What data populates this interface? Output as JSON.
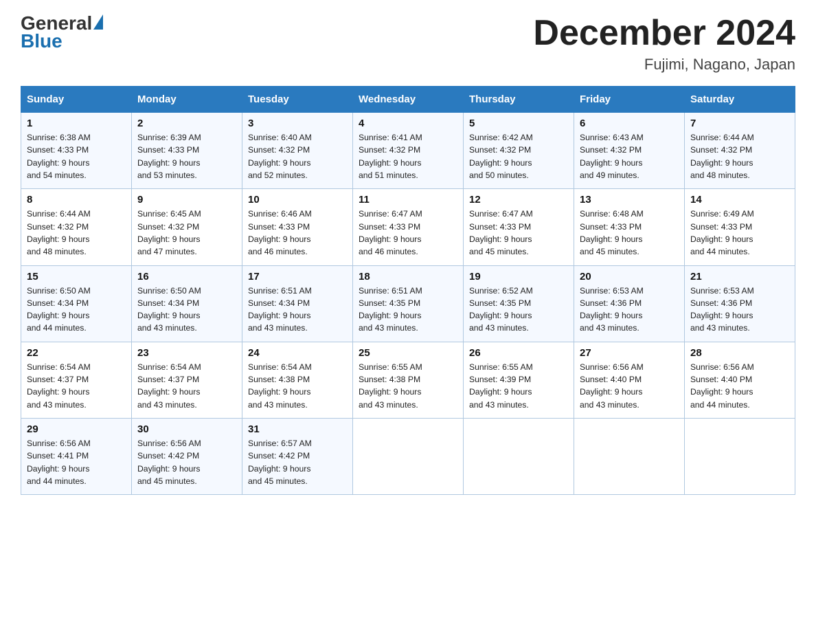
{
  "header": {
    "logo_general": "General",
    "logo_blue": "Blue",
    "month_title": "December 2024",
    "location": "Fujimi, Nagano, Japan"
  },
  "weekdays": [
    "Sunday",
    "Monday",
    "Tuesday",
    "Wednesday",
    "Thursday",
    "Friday",
    "Saturday"
  ],
  "weeks": [
    [
      {
        "day": "1",
        "sunrise": "6:38 AM",
        "sunset": "4:33 PM",
        "daylight": "9 hours and 54 minutes."
      },
      {
        "day": "2",
        "sunrise": "6:39 AM",
        "sunset": "4:33 PM",
        "daylight": "9 hours and 53 minutes."
      },
      {
        "day": "3",
        "sunrise": "6:40 AM",
        "sunset": "4:32 PM",
        "daylight": "9 hours and 52 minutes."
      },
      {
        "day": "4",
        "sunrise": "6:41 AM",
        "sunset": "4:32 PM",
        "daylight": "9 hours and 51 minutes."
      },
      {
        "day": "5",
        "sunrise": "6:42 AM",
        "sunset": "4:32 PM",
        "daylight": "9 hours and 50 minutes."
      },
      {
        "day": "6",
        "sunrise": "6:43 AM",
        "sunset": "4:32 PM",
        "daylight": "9 hours and 49 minutes."
      },
      {
        "day": "7",
        "sunrise": "6:44 AM",
        "sunset": "4:32 PM",
        "daylight": "9 hours and 48 minutes."
      }
    ],
    [
      {
        "day": "8",
        "sunrise": "6:44 AM",
        "sunset": "4:32 PM",
        "daylight": "9 hours and 48 minutes."
      },
      {
        "day": "9",
        "sunrise": "6:45 AM",
        "sunset": "4:32 PM",
        "daylight": "9 hours and 47 minutes."
      },
      {
        "day": "10",
        "sunrise": "6:46 AM",
        "sunset": "4:33 PM",
        "daylight": "9 hours and 46 minutes."
      },
      {
        "day": "11",
        "sunrise": "6:47 AM",
        "sunset": "4:33 PM",
        "daylight": "9 hours and 46 minutes."
      },
      {
        "day": "12",
        "sunrise": "6:47 AM",
        "sunset": "4:33 PM",
        "daylight": "9 hours and 45 minutes."
      },
      {
        "day": "13",
        "sunrise": "6:48 AM",
        "sunset": "4:33 PM",
        "daylight": "9 hours and 45 minutes."
      },
      {
        "day": "14",
        "sunrise": "6:49 AM",
        "sunset": "4:33 PM",
        "daylight": "9 hours and 44 minutes."
      }
    ],
    [
      {
        "day": "15",
        "sunrise": "6:50 AM",
        "sunset": "4:34 PM",
        "daylight": "9 hours and 44 minutes."
      },
      {
        "day": "16",
        "sunrise": "6:50 AM",
        "sunset": "4:34 PM",
        "daylight": "9 hours and 43 minutes."
      },
      {
        "day": "17",
        "sunrise": "6:51 AM",
        "sunset": "4:34 PM",
        "daylight": "9 hours and 43 minutes."
      },
      {
        "day": "18",
        "sunrise": "6:51 AM",
        "sunset": "4:35 PM",
        "daylight": "9 hours and 43 minutes."
      },
      {
        "day": "19",
        "sunrise": "6:52 AM",
        "sunset": "4:35 PM",
        "daylight": "9 hours and 43 minutes."
      },
      {
        "day": "20",
        "sunrise": "6:53 AM",
        "sunset": "4:36 PM",
        "daylight": "9 hours and 43 minutes."
      },
      {
        "day": "21",
        "sunrise": "6:53 AM",
        "sunset": "4:36 PM",
        "daylight": "9 hours and 43 minutes."
      }
    ],
    [
      {
        "day": "22",
        "sunrise": "6:54 AM",
        "sunset": "4:37 PM",
        "daylight": "9 hours and 43 minutes."
      },
      {
        "day": "23",
        "sunrise": "6:54 AM",
        "sunset": "4:37 PM",
        "daylight": "9 hours and 43 minutes."
      },
      {
        "day": "24",
        "sunrise": "6:54 AM",
        "sunset": "4:38 PM",
        "daylight": "9 hours and 43 minutes."
      },
      {
        "day": "25",
        "sunrise": "6:55 AM",
        "sunset": "4:38 PM",
        "daylight": "9 hours and 43 minutes."
      },
      {
        "day": "26",
        "sunrise": "6:55 AM",
        "sunset": "4:39 PM",
        "daylight": "9 hours and 43 minutes."
      },
      {
        "day": "27",
        "sunrise": "6:56 AM",
        "sunset": "4:40 PM",
        "daylight": "9 hours and 43 minutes."
      },
      {
        "day": "28",
        "sunrise": "6:56 AM",
        "sunset": "4:40 PM",
        "daylight": "9 hours and 44 minutes."
      }
    ],
    [
      {
        "day": "29",
        "sunrise": "6:56 AM",
        "sunset": "4:41 PM",
        "daylight": "9 hours and 44 minutes."
      },
      {
        "day": "30",
        "sunrise": "6:56 AM",
        "sunset": "4:42 PM",
        "daylight": "9 hours and 45 minutes."
      },
      {
        "day": "31",
        "sunrise": "6:57 AM",
        "sunset": "4:42 PM",
        "daylight": "9 hours and 45 minutes."
      },
      null,
      null,
      null,
      null
    ]
  ]
}
